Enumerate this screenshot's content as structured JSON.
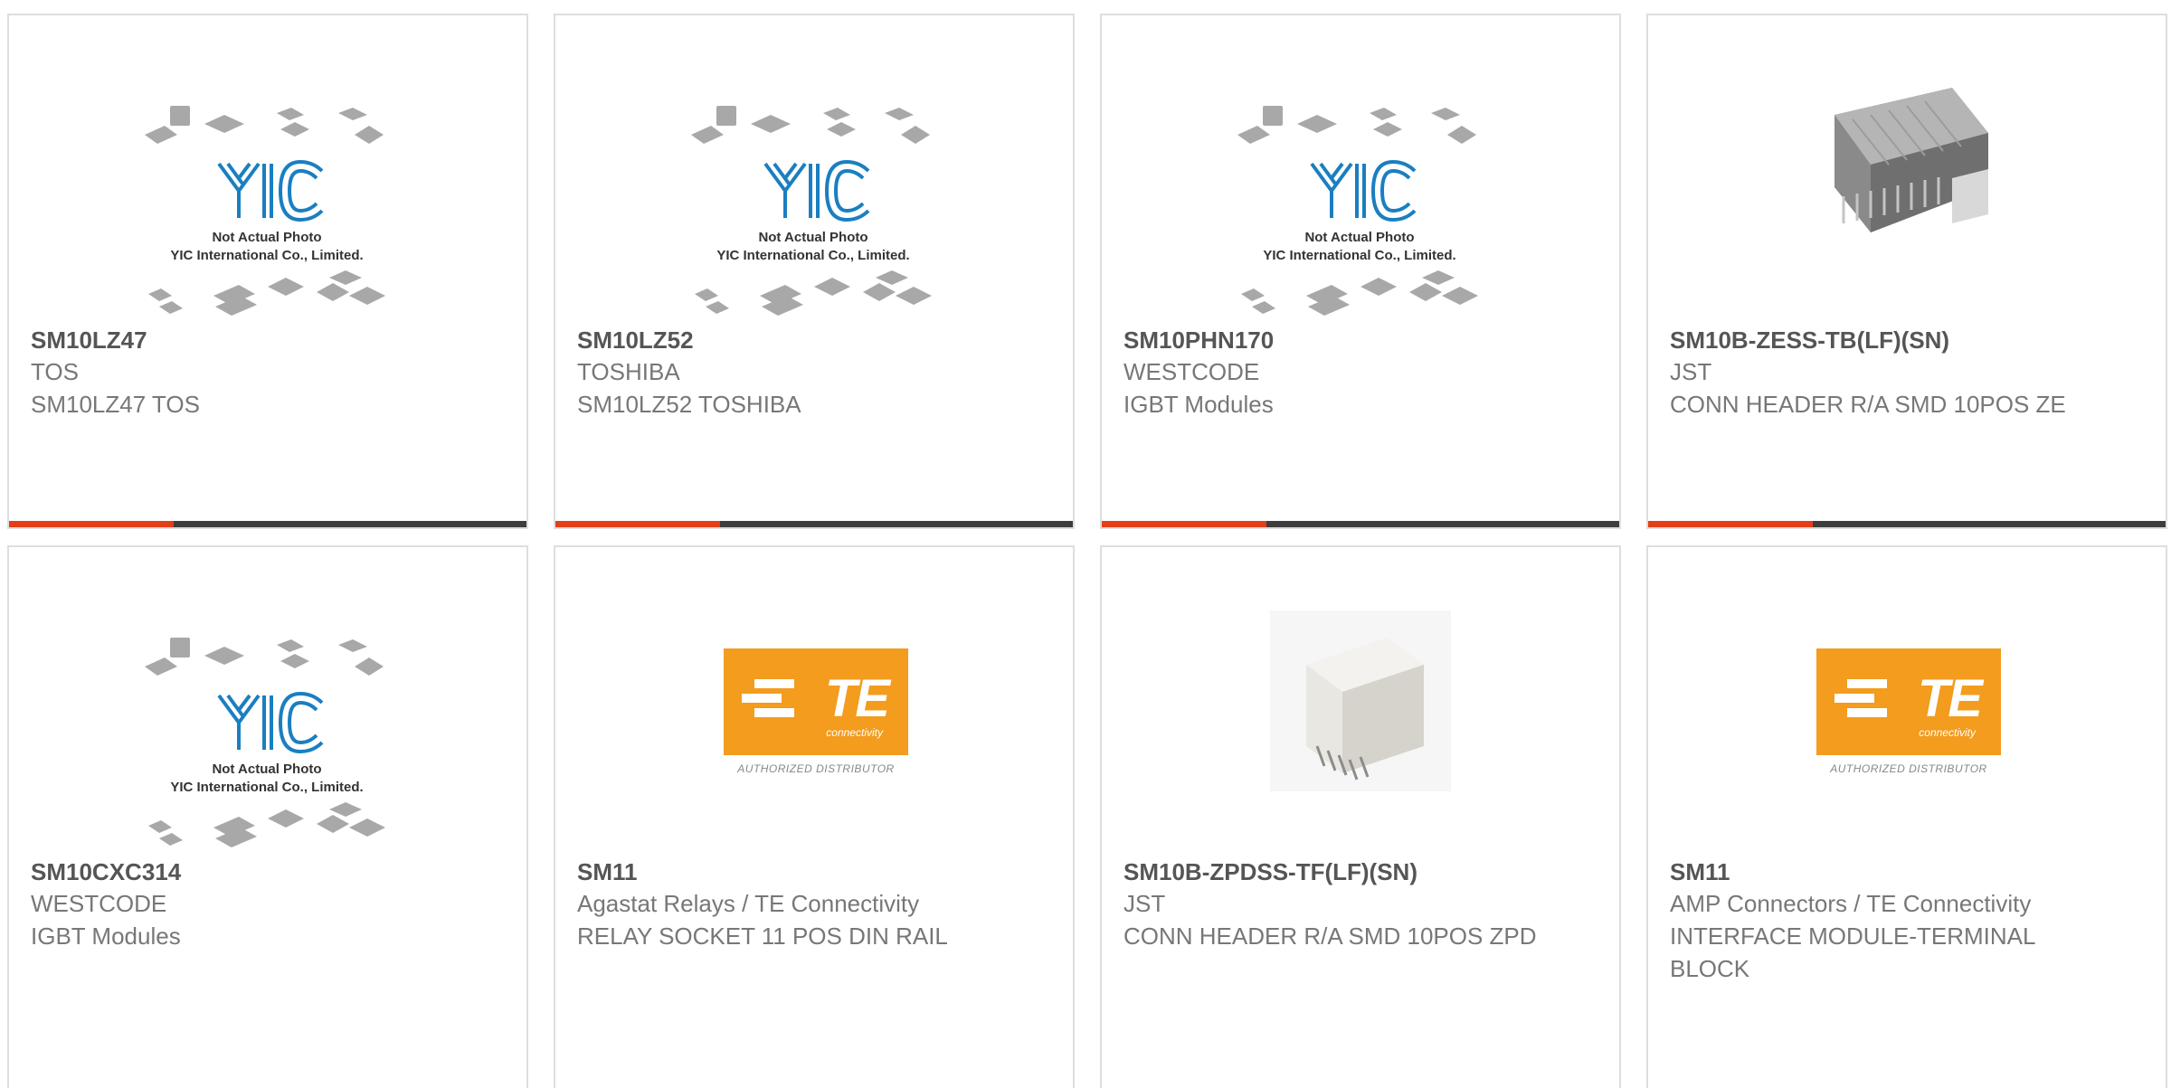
{
  "products": [
    {
      "part": "SM10LZ47",
      "manufacturer": "TOS",
      "description": "SM10LZ47 TOS",
      "image": "yic-placeholder"
    },
    {
      "part": "SM10LZ52",
      "manufacturer": "TOSHIBA",
      "description": "SM10LZ52 TOSHIBA",
      "image": "yic-placeholder"
    },
    {
      "part": "SM10PHN170",
      "manufacturer": "WESTCODE",
      "description": "IGBT Modules",
      "image": "yic-placeholder"
    },
    {
      "part": "SM10B-ZESS-TB(LF)(SN)",
      "manufacturer": "JST",
      "description": "CONN HEADER R/A SMD 10POS ZE",
      "image": "connector-photo"
    },
    {
      "part": "SM10CXC314",
      "manufacturer": "WESTCODE",
      "description": "IGBT Modules",
      "image": "yic-placeholder"
    },
    {
      "part": "SM11",
      "manufacturer": "Agastat Relays / TE Connectivity",
      "description": "RELAY SOCKET 11 POS DIN RAIL",
      "image": "te-logo"
    },
    {
      "part": "SM10B-ZPDSS-TF(LF)(SN)",
      "manufacturer": "JST",
      "description": "CONN HEADER R/A SMD 10POS ZPD",
      "image": "connector-photo"
    },
    {
      "part": "SM11",
      "manufacturer": "AMP Connectors / TE Connectivity",
      "description": "INTERFACE MODULE-TERMINAL BLOCK",
      "image": "te-logo"
    }
  ],
  "placeholder": {
    "line1": "Not Actual Photo",
    "line2": "YIC International Co., Limited.",
    "logo_text": "YIC"
  },
  "te": {
    "logo_text": "TE",
    "sub_text": "connectivity",
    "authorized_text": "AUTHORIZED DISTRIBUTOR"
  },
  "colors": {
    "accent": "#e3401a",
    "bar": "#3d3d3d",
    "te_orange": "#f39c1e",
    "yic_blue": "#1a7fc1"
  }
}
